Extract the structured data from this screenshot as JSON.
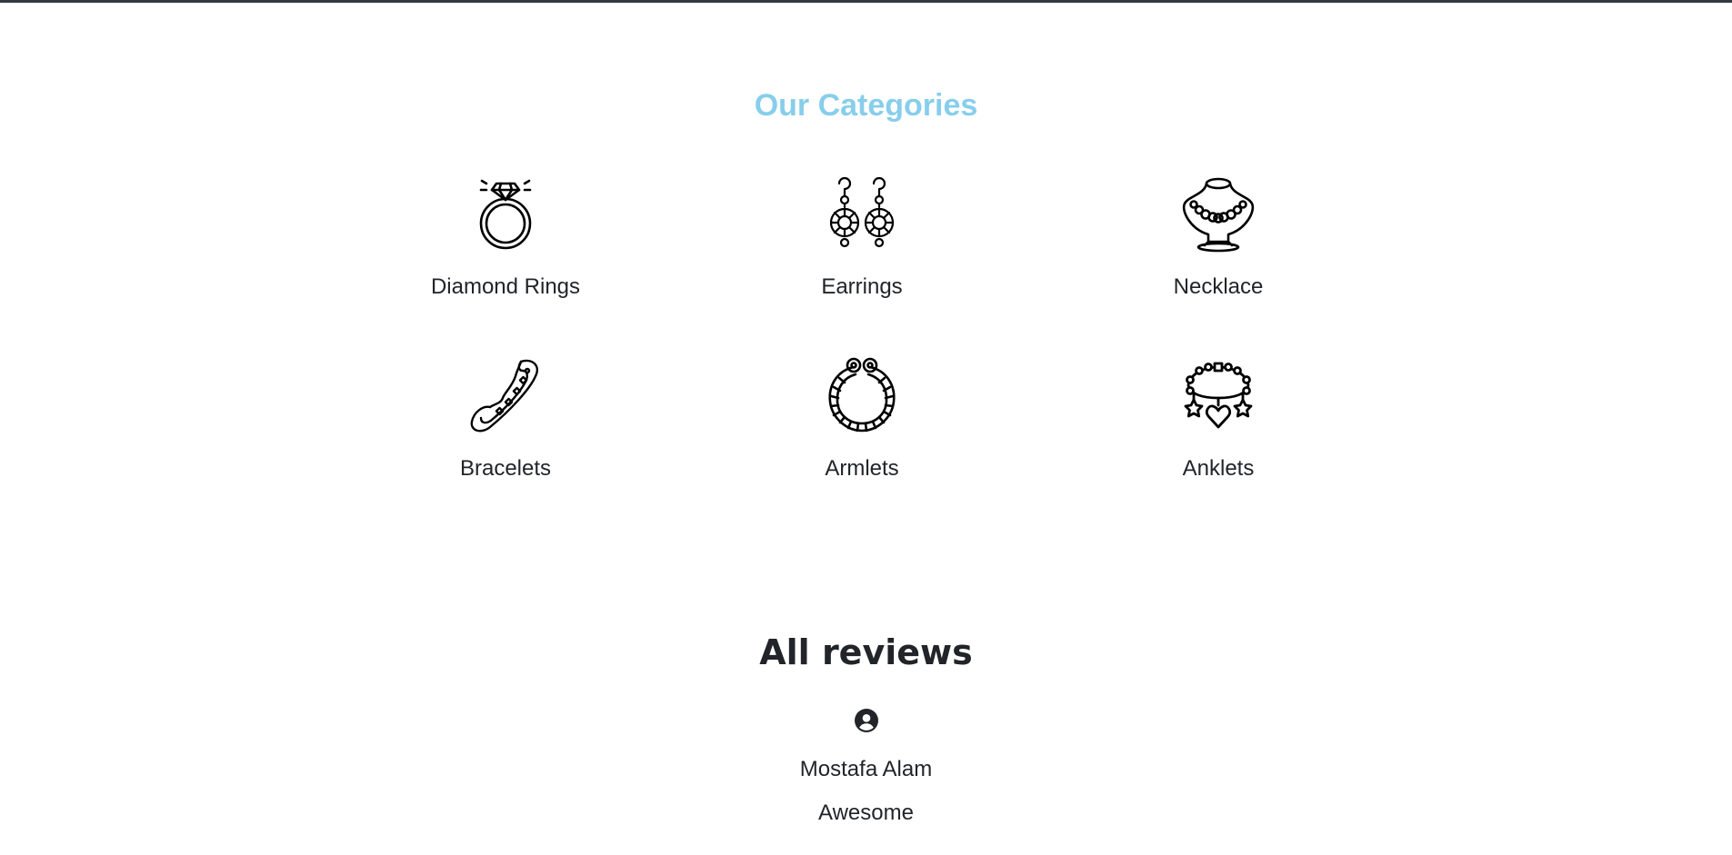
{
  "categories_section": {
    "title": "Our Categories",
    "title_color": "#87ceeb",
    "items": [
      {
        "label": "Diamond Rings",
        "icon": "diamond-ring-icon"
      },
      {
        "label": "Earrings",
        "icon": "earrings-icon"
      },
      {
        "label": "Necklace",
        "icon": "necklace-icon"
      },
      {
        "label": "Bracelets",
        "icon": "bracelet-icon"
      },
      {
        "label": "Armlets",
        "icon": "armlet-icon"
      },
      {
        "label": "Anklets",
        "icon": "anklet-icon"
      }
    ]
  },
  "reviews_section": {
    "title": "All reviews",
    "reviews": [
      {
        "icon": "user-circle-icon",
        "name": "Mostafa Alam",
        "text": "Awesome"
      }
    ]
  }
}
